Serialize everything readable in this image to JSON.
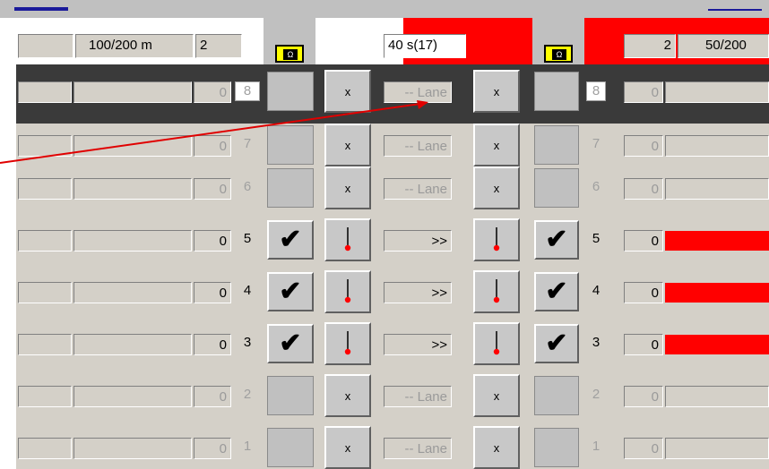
{
  "colors": {
    "accent_red": "#ff0000",
    "annotation_red": "#e00000",
    "badge_yellow": "#ffff00",
    "panel_gray": "#d4d0c8",
    "disabled_text": "#9a9a9a"
  },
  "header": {
    "left_blank": "",
    "left_distance": "100/200  m",
    "left_count": "2",
    "timer": "40 s(17)",
    "right_count": "2",
    "right_distance": "50/200",
    "badge_left_icon": "omega-icon",
    "badge_right_icon": "omega-icon",
    "badge_glyph": "Ω"
  },
  "lanes": [
    {
      "number": "8",
      "enabled": false,
      "left_value": "0",
      "middle_text": "-- Lane",
      "left_toggle": "x",
      "right_toggle": "x",
      "left_status": "",
      "right_status": "",
      "right_value": "0",
      "right_bar": false
    },
    {
      "number": "7",
      "enabled": false,
      "left_value": "0",
      "middle_text": "-- Lane",
      "left_toggle": "x",
      "right_toggle": "x",
      "left_status": "",
      "right_status": "",
      "right_value": "0",
      "right_bar": false
    },
    {
      "number": "6",
      "enabled": false,
      "left_value": "0",
      "middle_text": "-- Lane",
      "left_toggle": "x",
      "right_toggle": "x",
      "left_status": "",
      "right_status": "",
      "right_value": "0",
      "right_bar": false
    },
    {
      "number": "5",
      "enabled": true,
      "left_value": "0",
      "middle_text": ">>",
      "left_toggle": "pin-icon",
      "right_toggle": "pin-icon",
      "left_status": "✔",
      "right_status": "✔",
      "right_value": "0",
      "right_bar": true
    },
    {
      "number": "4",
      "enabled": true,
      "left_value": "0",
      "middle_text": ">>",
      "left_toggle": "pin-icon",
      "right_toggle": "pin-icon",
      "left_status": "✔",
      "right_status": "✔",
      "right_value": "0",
      "right_bar": true
    },
    {
      "number": "3",
      "enabled": true,
      "left_value": "0",
      "middle_text": ">>",
      "left_toggle": "pin-icon",
      "right_toggle": "pin-icon",
      "left_status": "✔",
      "right_status": "✔",
      "right_value": "0",
      "right_bar": true
    },
    {
      "number": "2",
      "enabled": false,
      "left_value": "0",
      "middle_text": "-- Lane",
      "left_toggle": "x",
      "right_toggle": "x",
      "left_status": "",
      "right_status": "",
      "right_value": "0",
      "right_bar": false
    },
    {
      "number": "1",
      "enabled": false,
      "left_value": "0",
      "middle_text": "-- Lane",
      "left_toggle": "x",
      "right_toggle": "x",
      "left_status": "",
      "right_status": "",
      "right_value": "0",
      "right_bar": false
    }
  ]
}
